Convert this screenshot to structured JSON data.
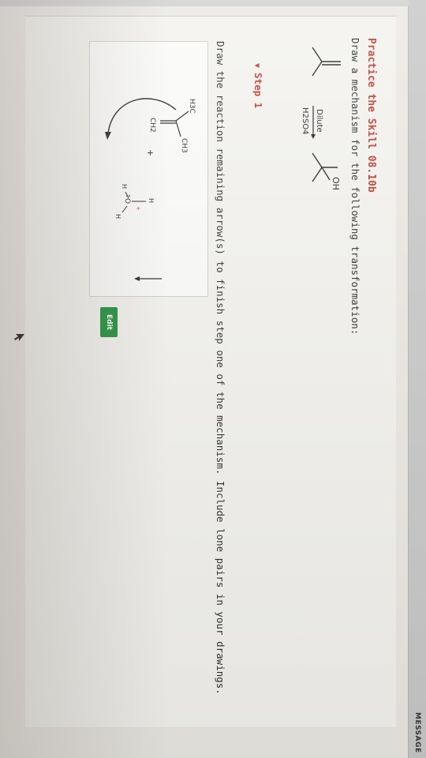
{
  "toolbar": {
    "message_label": "MESSAGE"
  },
  "problem": {
    "title": "Practice the Skill 08.10b",
    "prompt": "Draw a mechanism for the following transformation:",
    "reagent_top": "Dilute",
    "reagent_bottom": "H2SO4",
    "product_group": "OH"
  },
  "step": {
    "label": "Step 1",
    "instruction": "Draw the reaction remaining arrow(s) to finish step one of the mechanism. Include lone pairs in your drawings."
  },
  "drawing": {
    "reactant_methyl": "CH3",
    "reactant_h3c": "H3C",
    "reactant_ch2": "CH2",
    "plus": "+",
    "hydronium_h_top": "H",
    "hydronium_h_left": "H",
    "hydronium_o": "O",
    "hydronium_charge": "+",
    "hydronium_h_right": "H"
  },
  "actions": {
    "edit_label": "Edit"
  },
  "colors": {
    "accent_red": "#c0392b",
    "edit_green": "#1f8f3a"
  }
}
